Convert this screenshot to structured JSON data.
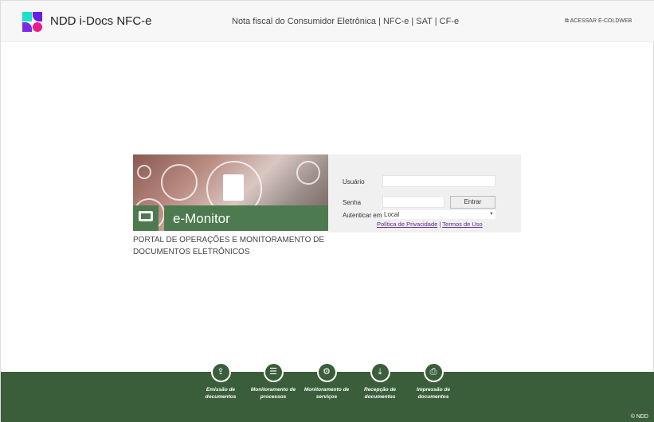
{
  "header": {
    "brand": "NDD i-Docs NFC-e",
    "subtitle": "Nota fiscal do Consumidor Eletrônica | NFC-e | SAT | CF-e",
    "external_link": "ACESSAR E-COLDWEB",
    "logo_colors": [
      "#1de0c8",
      "#6a1de8",
      "#7a2de0",
      "#ee1a8a"
    ]
  },
  "banner": {
    "title": "e-Monitor",
    "description": "PORTAL DE OPERAÇÕES E MONITORAMENTO DE DOCUMENTOS ELETRÔNICOS",
    "accent": "#4d7a4f"
  },
  "login": {
    "user_label": "Usuário",
    "user_value": "",
    "password_label": "Senha",
    "password_value": "",
    "submit_label": "Entrar",
    "auth_label": "Autenticar em",
    "auth_value": "Local",
    "privacy_link": "Política de Privacidade",
    "separator": "|",
    "terms_link": "Termos de Uso"
  },
  "footer": {
    "items": [
      {
        "label": "Emissão de documentos",
        "icon": "upload-tray-icon"
      },
      {
        "label": "Monitoramento de processos",
        "icon": "sliders-icon"
      },
      {
        "label": "Monitoramento de serviços",
        "icon": "gears-icon"
      },
      {
        "label": "Recepção de documentos",
        "icon": "download-tray-icon"
      },
      {
        "label": "Impressão de documentos",
        "icon": "printer-icon"
      }
    ],
    "copyright": "© NDD",
    "color": "#3a5e3a"
  }
}
